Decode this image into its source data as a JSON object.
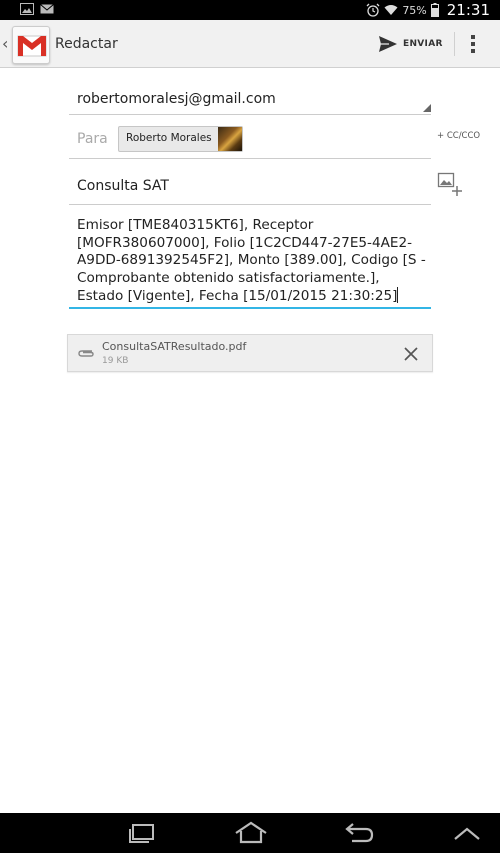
{
  "status_bar": {
    "battery": "75%",
    "time": "21:31",
    "icons": [
      "gallery-icon",
      "mail-icon",
      "alarm-icon",
      "wifi-icon",
      "battery-icon"
    ]
  },
  "action_bar": {
    "title": "Redactar",
    "send_label": "ENVIAR"
  },
  "compose": {
    "from": "robertomoralesj@gmail.com",
    "to_label": "Para",
    "recipient": "Roberto Morales",
    "cc_label": "+ CC/CCO",
    "subject": "Consulta SAT",
    "body": "Emisor [TME840315KT6], Receptor [MOFR380607000], Folio [1C2CD447-27E5-4AE2-A9DD-6891392545F2], Monto [389.00], Codigo [S - Comprobante obtenido satisfactoriamente.], Estado [Vigente], Fecha [15/01/2015 21:30:25]"
  },
  "attachment": {
    "name": "ConsultaSATResultado.pdf",
    "size": "19 KB"
  },
  "colors": {
    "accent": "#33b5e5",
    "gmail_red": "#d93025",
    "status_bar": "#000000",
    "action_bar": "#f1f1f1"
  }
}
